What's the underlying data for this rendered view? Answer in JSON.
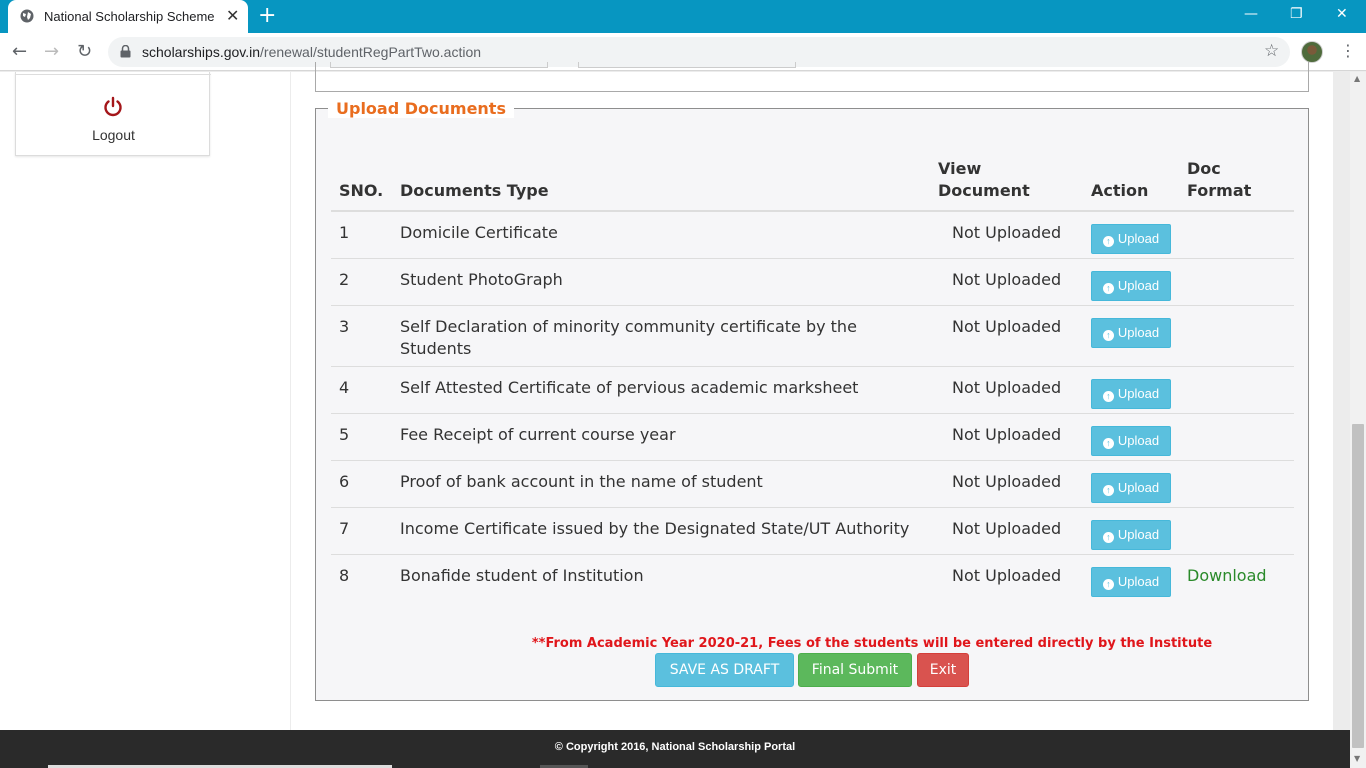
{
  "browser": {
    "tab_title": "National Scholarship Scheme",
    "url_host": "scholarships.gov.in",
    "url_path": "/renewal/studentRegPartTwo.action"
  },
  "sidebar": {
    "logout_label": "Logout",
    "power_icon": "power-icon"
  },
  "upload": {
    "legend": "Upload Documents",
    "headers": {
      "sno": "SNO.",
      "type": "Documents Type",
      "view": "View Document",
      "action": "Action",
      "format": "Doc Format"
    },
    "rows": [
      {
        "sno": "1",
        "type": "Domicile Certificate",
        "status": "Not Uploaded",
        "action": "Upload",
        "format": ""
      },
      {
        "sno": "2",
        "type": "Student PhotoGraph",
        "status": "Not Uploaded",
        "action": "Upload",
        "format": ""
      },
      {
        "sno": "3",
        "type": "Self Declaration of minority community certificate by the Students",
        "status": "Not Uploaded",
        "action": "Upload",
        "format": ""
      },
      {
        "sno": "4",
        "type": "Self Attested Certificate of pervious academic marksheet",
        "status": "Not Uploaded",
        "action": "Upload",
        "format": ""
      },
      {
        "sno": "5",
        "type": "Fee Receipt of current course year",
        "status": "Not Uploaded",
        "action": "Upload",
        "format": ""
      },
      {
        "sno": "6",
        "type": "Proof of bank account in the name of student",
        "status": "Not Uploaded",
        "action": "Upload",
        "format": ""
      },
      {
        "sno": "7",
        "type": "Income Certificate issued by the Designated State/UT Authority",
        "status": "Not Uploaded",
        "action": "Upload",
        "format": ""
      },
      {
        "sno": "8",
        "type": "Bonafide student of Institution",
        "status": "Not Uploaded",
        "action": "Upload",
        "format": "Download"
      }
    ],
    "note": "**From Academic Year 2020-21, Fees of the students will be entered directly by the Institute",
    "buttons": {
      "draft": "SAVE AS DRAFT",
      "submit": "Final Submit",
      "exit": "Exit"
    }
  },
  "footer": {
    "copyright": "© Copyright 2016, National Scholarship Portal"
  },
  "colors": {
    "legend": "#e96d1f",
    "upload_button": "#5bc0de",
    "submit_button": "#5cb85c",
    "exit_button": "#d9534f",
    "note": "#e0161b",
    "download_link": "#2a8a2a"
  }
}
